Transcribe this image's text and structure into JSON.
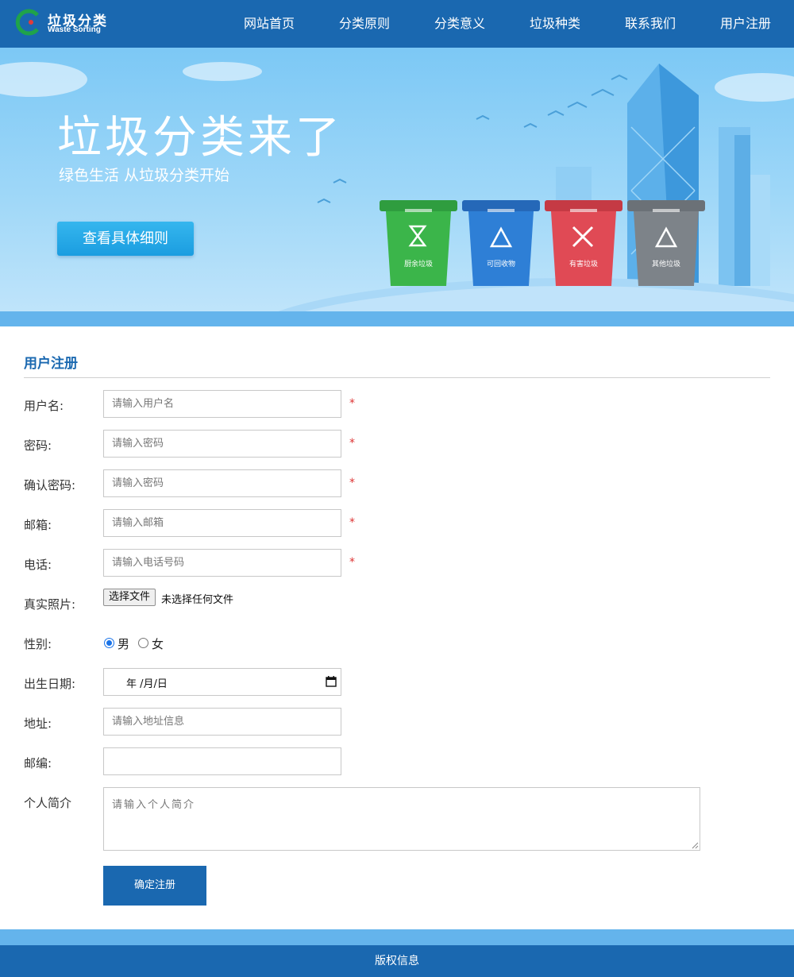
{
  "logo": {
    "title_cn": "垃圾分类",
    "title_en": "Waste Sorting"
  },
  "nav": {
    "items": [
      "网站首页",
      "分类原则",
      "分类意义",
      "垃圾种类",
      "联系我们",
      "用户注册"
    ]
  },
  "banner": {
    "title": "垃圾分类来了",
    "subtitle": "绿色生活 从垃圾分类开始",
    "button": "查看具体细则",
    "bins": [
      {
        "label": "厨余垃圾",
        "color": "#3bb54a"
      },
      {
        "label": "可回收物",
        "color": "#2e7fd6"
      },
      {
        "label": "有害垃圾",
        "color": "#e04a55"
      },
      {
        "label": "其他垃圾",
        "color": "#7d8389"
      }
    ]
  },
  "form": {
    "title": "用户注册",
    "username": {
      "label": "用户名:",
      "placeholder": "请输入用户名",
      "required": "*"
    },
    "password": {
      "label": "密码:",
      "placeholder": "请输入密码",
      "required": "*"
    },
    "confirm": {
      "label": "确认密码:",
      "placeholder": "请输入密码",
      "required": "*"
    },
    "email": {
      "label": "邮箱:",
      "placeholder": "请输入邮箱",
      "required": "*"
    },
    "phone": {
      "label": "电话:",
      "placeholder": "请输入电话号码",
      "required": "*"
    },
    "photo": {
      "label": "真实照片:",
      "button": "选择文件",
      "status": "未选择任何文件"
    },
    "gender": {
      "label": "性别:",
      "male": "男",
      "female": "女",
      "selected": "男"
    },
    "birthday": {
      "label": "出生日期:",
      "value": "年 /月/日"
    },
    "address": {
      "label": "地址:",
      "placeholder": "请输入地址信息"
    },
    "postcode": {
      "label": "邮编:",
      "value": ""
    },
    "intro": {
      "label": "个人简介",
      "placeholder": "请输入个人简介"
    },
    "submit": "确定注册"
  },
  "footer": {
    "text": "版权信息"
  },
  "colors": {
    "primary": "#1a68b0",
    "accent_strip": "#64b4ec",
    "required": "#dd3333"
  }
}
